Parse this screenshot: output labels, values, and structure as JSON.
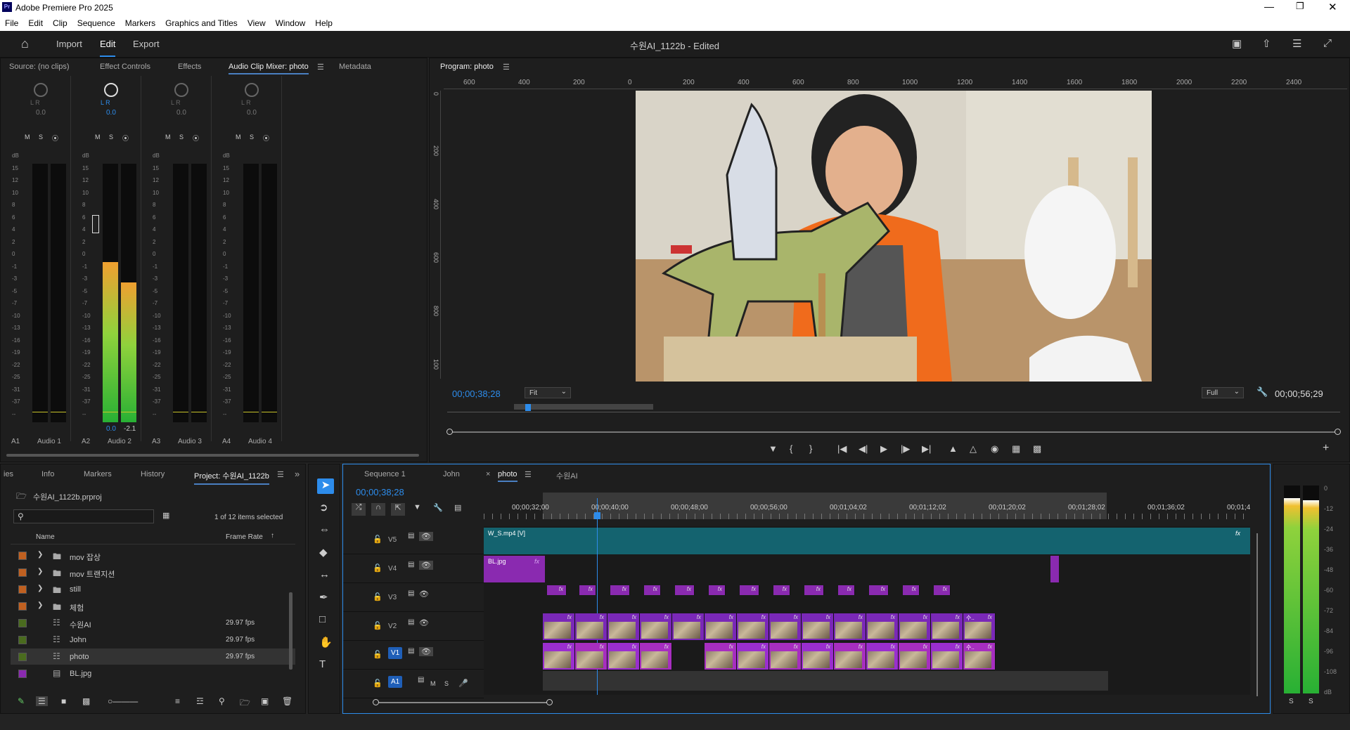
{
  "app": {
    "title": "Adobe Premiere Pro 2025",
    "icon_label": "Pr",
    "menu": [
      "File",
      "Edit",
      "Clip",
      "Sequence",
      "Markers",
      "Graphics and Titles",
      "View",
      "Window",
      "Help"
    ],
    "header_tabs": [
      "Import",
      "Edit",
      "Export"
    ],
    "active_header_tab": "Edit",
    "project_title": "수원AI_1122b - Edited"
  },
  "left_panel": {
    "tabs": [
      "Source: (no clips)",
      "Effect Controls",
      "Effects",
      "Audio Clip Mixer: photo",
      "Metadata"
    ],
    "active_tab": "Audio Clip Mixer: photo",
    "channels": [
      {
        "id": "A1",
        "name": "Audio 1",
        "pan": "0.0",
        "level_l": null,
        "level_r": null,
        "meter_l": 0,
        "meter_r": 0
      },
      {
        "id": "A2",
        "name": "Audio 2",
        "pan": "0.0",
        "level_l": "0.0",
        "level_r": "-2.1",
        "meter_l": 0.62,
        "meter_r": 0.54
      },
      {
        "id": "A3",
        "name": "Audio 3",
        "pan": "0.0",
        "level_l": null,
        "level_r": null,
        "meter_l": 0,
        "meter_r": 0
      },
      {
        "id": "A4",
        "name": "Audio 4",
        "pan": "0.0",
        "level_l": null,
        "level_r": null,
        "meter_l": 0,
        "meter_r": 0
      }
    ],
    "msr": [
      "M",
      "S",
      "⦿"
    ],
    "lr": "L R",
    "scale": [
      "dB",
      "15",
      "12",
      "10",
      "8",
      "6",
      "4",
      "2",
      "0",
      "-1",
      "-3",
      "-5",
      "-7",
      "-10",
      "-13",
      "-16",
      "-19",
      "-22",
      "-25",
      "-31",
      "-37",
      "--"
    ]
  },
  "program": {
    "title": "Program: photo",
    "timecode": "00;00;38;28",
    "duration": "00;00;56;29",
    "fit": "Fit",
    "quality": "Full",
    "ruler": [
      "600",
      "400",
      "200",
      "0",
      "200",
      "400",
      "600",
      "800",
      "1000",
      "1200",
      "1400",
      "1600",
      "1800",
      "2000",
      "2200",
      "2400"
    ],
    "vruler": [
      "0",
      "200",
      "400",
      "600",
      "800",
      "100"
    ],
    "playhead_fraction": 0.09
  },
  "project": {
    "tabs": [
      "ies",
      "Info",
      "Markers",
      "History",
      "Project: 수원AI_1122b"
    ],
    "file": "수원AI_1122b.prproj",
    "selection": "1 of 12 items selected",
    "col_name": "Name",
    "col_rate": "Frame Rate",
    "items": [
      {
        "name": "mov 잡상",
        "type": "folder",
        "rate": "",
        "color": "#c06020"
      },
      {
        "name": "mov 트랜지션",
        "type": "folder",
        "rate": "",
        "color": "#c06020"
      },
      {
        "name": "still",
        "type": "folder",
        "rate": "",
        "color": "#c06020"
      },
      {
        "name": "체험",
        "type": "folder",
        "rate": "",
        "color": "#c06020"
      },
      {
        "name": "수원AI",
        "type": "sequence",
        "rate": "29.97 fps",
        "color": "#4a6b1e"
      },
      {
        "name": "John",
        "type": "sequence",
        "rate": "29.97 fps",
        "color": "#4a6b1e"
      },
      {
        "name": "photo",
        "type": "sequence",
        "rate": "29.97 fps",
        "color": "#4a6b1e"
      },
      {
        "name": "BL.jpg",
        "type": "image",
        "rate": "",
        "color": "#8a2ab0"
      }
    ]
  },
  "timeline": {
    "tabs": [
      "Sequence 1",
      "John",
      "photo",
      "수원AI"
    ],
    "active_tab": "photo",
    "timecode": "00;00;38;28",
    "ruler": [
      "00;00;32;00",
      "00;00;40;00",
      "00;00;48;00",
      "00;00;56;00",
      "00;01;04;02",
      "00;01;12;02",
      "00;01;20;02",
      "00;01;28;02",
      "00;01;36;02",
      "00;01;4"
    ],
    "tracks": [
      "V5",
      "V4",
      "V3",
      "V2",
      "V1",
      "A1"
    ],
    "clip_v5": "W_S.mp4 [V]",
    "clip_v4": "BL.jpg",
    "clip_v2_text": "수..",
    "fx": "fx"
  },
  "right_meter": {
    "scale": [
      "0",
      "-12",
      "-24",
      "-36",
      "-48",
      "-60",
      "-72",
      "-84",
      "-96",
      "-108",
      "dB"
    ],
    "sr": [
      "S",
      "S"
    ],
    "level_l": 0.94,
    "level_r": 0.93
  },
  "colors": {
    "accent": "#2d8ceb",
    "clip_purple": "#8a2ab0",
    "clip_teal": "#14636f",
    "meter_green": "#43c43c"
  }
}
